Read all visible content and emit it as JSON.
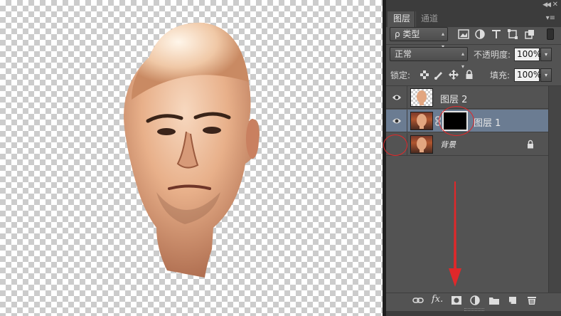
{
  "panel": {
    "tabs": [
      {
        "label": "图层",
        "active": true
      },
      {
        "label": "通道",
        "active": false
      }
    ],
    "filter": {
      "label": "ρ 类型"
    },
    "blend_mode": "正常",
    "opacity_label": "不透明度:",
    "opacity_value": "100%",
    "lock_label": "锁定:",
    "fill_label": "填充:",
    "fill_value": "100%"
  },
  "layers": [
    {
      "name": "图层 2",
      "visible": true,
      "selected": false,
      "has_mask": false
    },
    {
      "name": "图层 1",
      "visible": true,
      "selected": true,
      "has_mask": true
    },
    {
      "name": "背景",
      "visible": false,
      "selected": false,
      "locked": true
    }
  ],
  "bottom_toolbar": {
    "fx_label": "fx."
  },
  "colors": {
    "panel_bg": "#535353",
    "selected_layer": "#6b7c92",
    "annotation": "#e0282a"
  },
  "icons": [
    "link-layers-icon",
    "fx-icon",
    "add-mask-icon",
    "adjustment-layer-icon",
    "new-group-icon",
    "new-layer-icon",
    "trash-icon"
  ]
}
